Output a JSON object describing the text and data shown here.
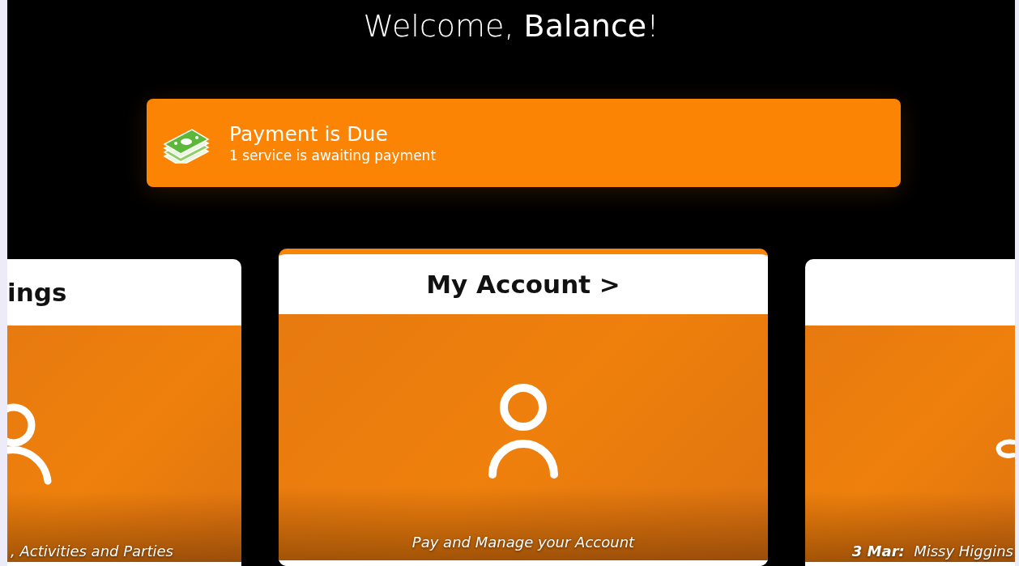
{
  "header": {
    "greeting": "Welcome, **Balance**!"
  },
  "alert": {
    "title": "Payment is Due",
    "message": "1 service is awaiting payment"
  },
  "cards": [
    {
      "title": "ings",
      "subtitle": ", Activities and Parties",
      "selected": false
    },
    {
      "title": "My Account >",
      "subtitle": "Pay and Manage your Account",
      "selected": true
    },
    {
      "subtitle": "**3 Mar:**  Missy Higgins",
      "selected": false
    }
  ]
}
